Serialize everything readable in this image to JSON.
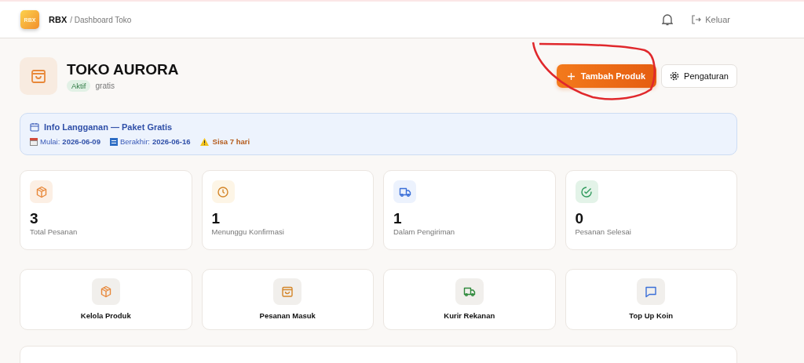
{
  "header": {
    "logo": "RBX",
    "brand": "RBX",
    "breadcrumb": "/ Dashboard Toko",
    "logout": "Keluar"
  },
  "store": {
    "name": "TOKO AURORA",
    "status": "Aktif",
    "plan": "gratis"
  },
  "actions": {
    "primary": "Tambah Produk",
    "settings": "Pengaturan"
  },
  "subscription": {
    "title": "Info Langganan — Paket Gratis",
    "start_label": "Mulai:",
    "start": "2026-06-09",
    "end_label": "Berakhir:",
    "end": "2026-06-16",
    "remaining": "Sisa 7 hari"
  },
  "stats": [
    {
      "kind": "box",
      "color": "#e8883a",
      "value": "3",
      "label": "Total Pesanan"
    },
    {
      "kind": "clock",
      "color": "#d4862a",
      "value": "1",
      "label": "Menunggu Konfirmasi"
    },
    {
      "kind": "truck",
      "color": "#3b6fd8",
      "value": "1",
      "label": "Dalam Pengiriman"
    },
    {
      "kind": "check",
      "color": "#2f9a5c",
      "value": "0",
      "label": "Pesanan Selesai"
    }
  ],
  "shortcuts": [
    {
      "kind": "box",
      "color": "#e8883a",
      "label": "Kelola Produk"
    },
    {
      "kind": "bag",
      "color": "#d4862a",
      "label": "Pesanan Masuk"
    },
    {
      "kind": "truck",
      "color": "#2f8a3c",
      "label": "Kurir Rekanan"
    },
    {
      "kind": "chat",
      "color": "#3b6fd8",
      "label": "Top Up Koin"
    }
  ]
}
